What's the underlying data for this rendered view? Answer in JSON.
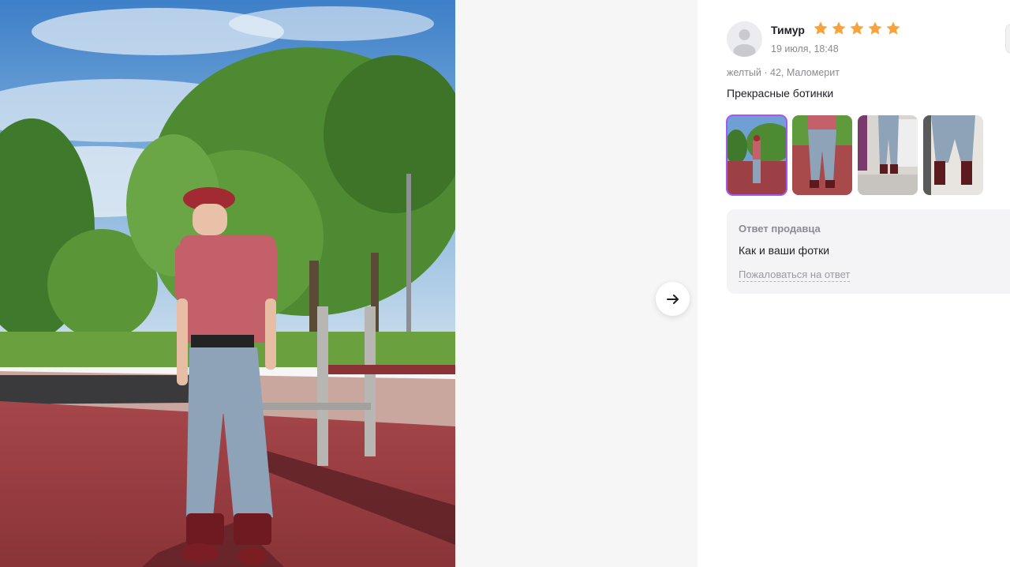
{
  "review": {
    "author": "Тимур",
    "rating": 5,
    "date": "19 июля, 18:48",
    "variant": "желтый · 42, Маломерит",
    "text": "Прекрасные ботинки"
  },
  "photos": {
    "count": 4,
    "selected_index": 0
  },
  "seller_reply": {
    "title": "Ответ продавца",
    "text": "Как и ваши фотки",
    "complain_link": "Пожаловаться на ответ"
  },
  "icons": {
    "next": "arrow-right-icon",
    "avatar": "user-avatar-icon",
    "star": "star-icon"
  },
  "colors": {
    "star": "#f7a23b",
    "accent": "#a855f7",
    "reply_bg": "#f4f4f6",
    "muted_text": "#8b8b94"
  }
}
